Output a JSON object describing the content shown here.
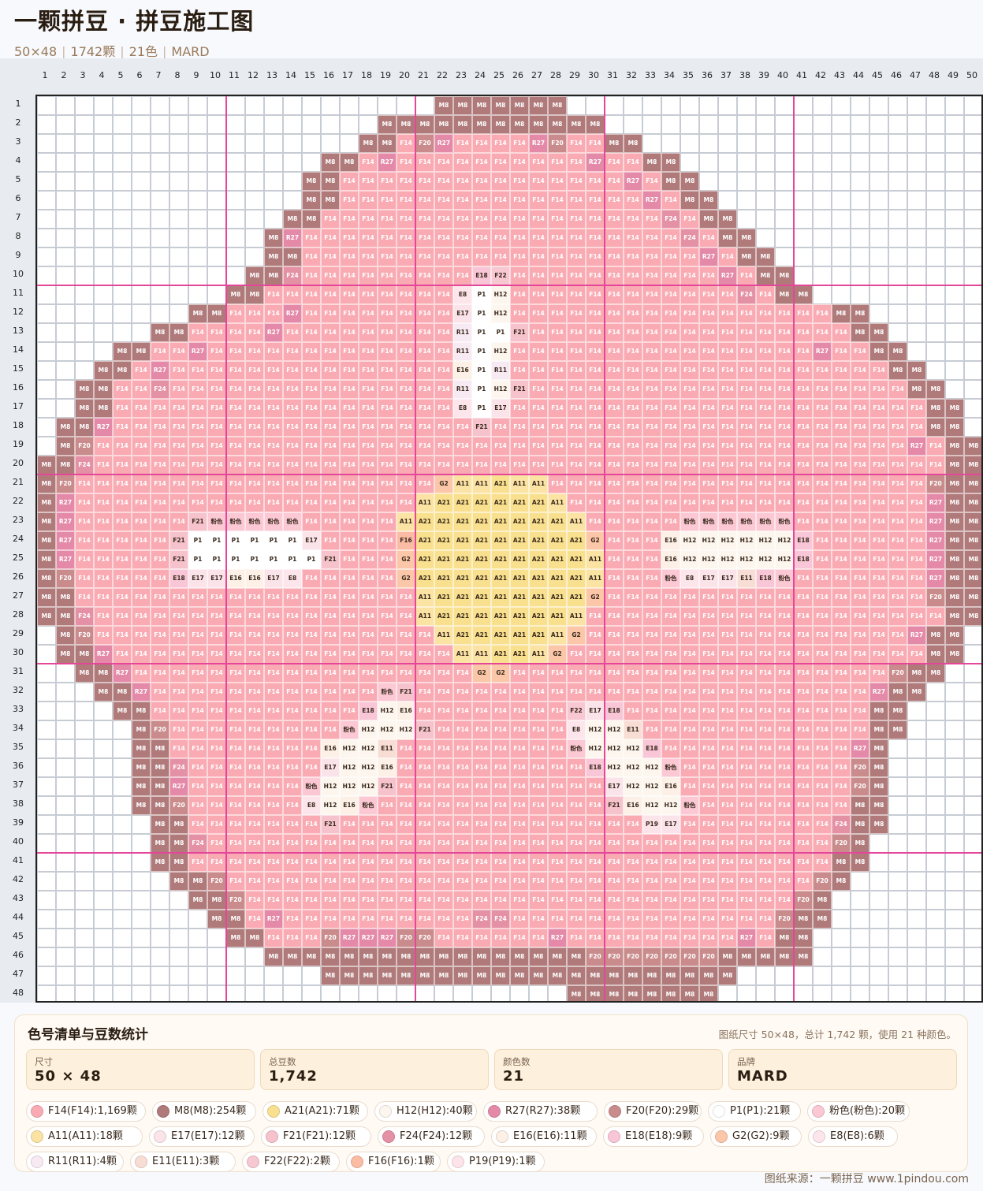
{
  "header": {
    "title": "一颗拼豆 · 拼豆施工图",
    "meta": [
      "50×48",
      "1742颗",
      "21色",
      "MARD"
    ]
  },
  "grid": {
    "cols": 50,
    "rows": 48,
    "col_numbers": [
      "1",
      "2",
      "3",
      "4",
      "5",
      "6",
      "7",
      "8",
      "9",
      "10",
      "11",
      "12",
      "13",
      "14",
      "15",
      "16",
      "17",
      "18",
      "19",
      "20",
      "21",
      "22",
      "23",
      "24",
      "25",
      "26",
      "27",
      "28",
      "29",
      "30",
      "31",
      "32",
      "33",
      "34",
      "35",
      "36",
      "37",
      "38",
      "39",
      "40",
      "41",
      "42",
      "43",
      "44",
      "45",
      "46",
      "47",
      "48",
      "49",
      "50"
    ],
    "row_numbers": [
      "1",
      "2",
      "3",
      "4",
      "5",
      "6",
      "7",
      "8",
      "9",
      "10",
      "11",
      "12",
      "13",
      "14",
      "15",
      "16",
      "17",
      "18",
      "19",
      "20",
      "21",
      "22",
      "23",
      "24",
      "25",
      "26",
      "27",
      "28",
      "29",
      "30",
      "31",
      "32",
      "33",
      "34",
      "35",
      "36",
      "37",
      "38",
      "39",
      "40",
      "41",
      "42",
      "43",
      "44",
      "45",
      "46",
      "47",
      "48"
    ],
    "highlight_line_color": "#e4479a",
    "palette": {
      "M8": "#b07a7a",
      "F14": "#f9aab2",
      "A21": "#f8e08e",
      "A11": "#fbe3a4",
      "H12": "#fdf6ee",
      "R27": "#e48aa8",
      "F20": "#c98b8b",
      "P1": "#ffffff",
      "粉色": "#fbc8d4",
      "E17": "#fbe3ea",
      "F21": "#f6c3cd",
      "F24": "#e591a5",
      "E16": "#fdf0e6",
      "E18": "#f8c6d6",
      "G2": "#fbc7a8",
      "E8": "#fde5ec",
      "R11": "#f8eaf3",
      "E11": "#f8ddd4",
      "F22": "#f8c8d2",
      "F16": "#fcbca3",
      "P19": "#fde4ea"
    }
  },
  "stats": {
    "title": "色号清单与豆数统计",
    "summary": "图纸尺寸 50×48，总计 1,742 颗，使用 21 种颜色。",
    "cards": [
      {
        "label": "尺寸",
        "value": "50 × 48"
      },
      {
        "label": "总豆数",
        "value": "1,742"
      },
      {
        "label": "颜色数",
        "value": "21"
      },
      {
        "label": "品牌",
        "value": "MARD"
      }
    ],
    "chips": [
      {
        "text": "F14(F14):1,169颗",
        "color": "#f9aab2"
      },
      {
        "text": "M8(M8):254颗",
        "color": "#b07a7a"
      },
      {
        "text": "A21(A21):71颗",
        "color": "#f8e08e"
      },
      {
        "text": "H12(H12):40颗",
        "color": "#fdf6ee"
      },
      {
        "text": "R27(R27):38颗",
        "color": "#e48aa8"
      },
      {
        "text": "F20(F20):29颗",
        "color": "#c98b8b"
      },
      {
        "text": "P1(P1):21颗",
        "color": "#ffffff"
      },
      {
        "text": "粉色(粉色):20颗",
        "color": "#fbc8d4"
      },
      {
        "text": "A11(A11):18颗",
        "color": "#fbe3a4"
      },
      {
        "text": "E17(E17):12颗",
        "color": "#fbe3ea"
      },
      {
        "text": "F21(F21):12颗",
        "color": "#f6c3cd"
      },
      {
        "text": "F24(F24):12颗",
        "color": "#e591a5"
      },
      {
        "text": "E16(E16):11颗",
        "color": "#fdf0e6"
      },
      {
        "text": "E18(E18):9颗",
        "color": "#f8c6d6"
      },
      {
        "text": "G2(G2):9颗",
        "color": "#fbc7a8"
      },
      {
        "text": "E8(E8):6颗",
        "color": "#fde5ec"
      },
      {
        "text": "R11(R11):4颗",
        "color": "#f8eaf3"
      },
      {
        "text": "E11(E11):3颗",
        "color": "#f8ddd4"
      },
      {
        "text": "F22(F22):2颗",
        "color": "#f8c8d2"
      },
      {
        "text": "F16(F16):1颗",
        "color": "#fcbca3"
      },
      {
        "text": "P19(P19):1颗",
        "color": "#fde4ea"
      }
    ]
  },
  "footer": {
    "source": "图纸来源：一颗拼豆 www.1pindou.com"
  }
}
